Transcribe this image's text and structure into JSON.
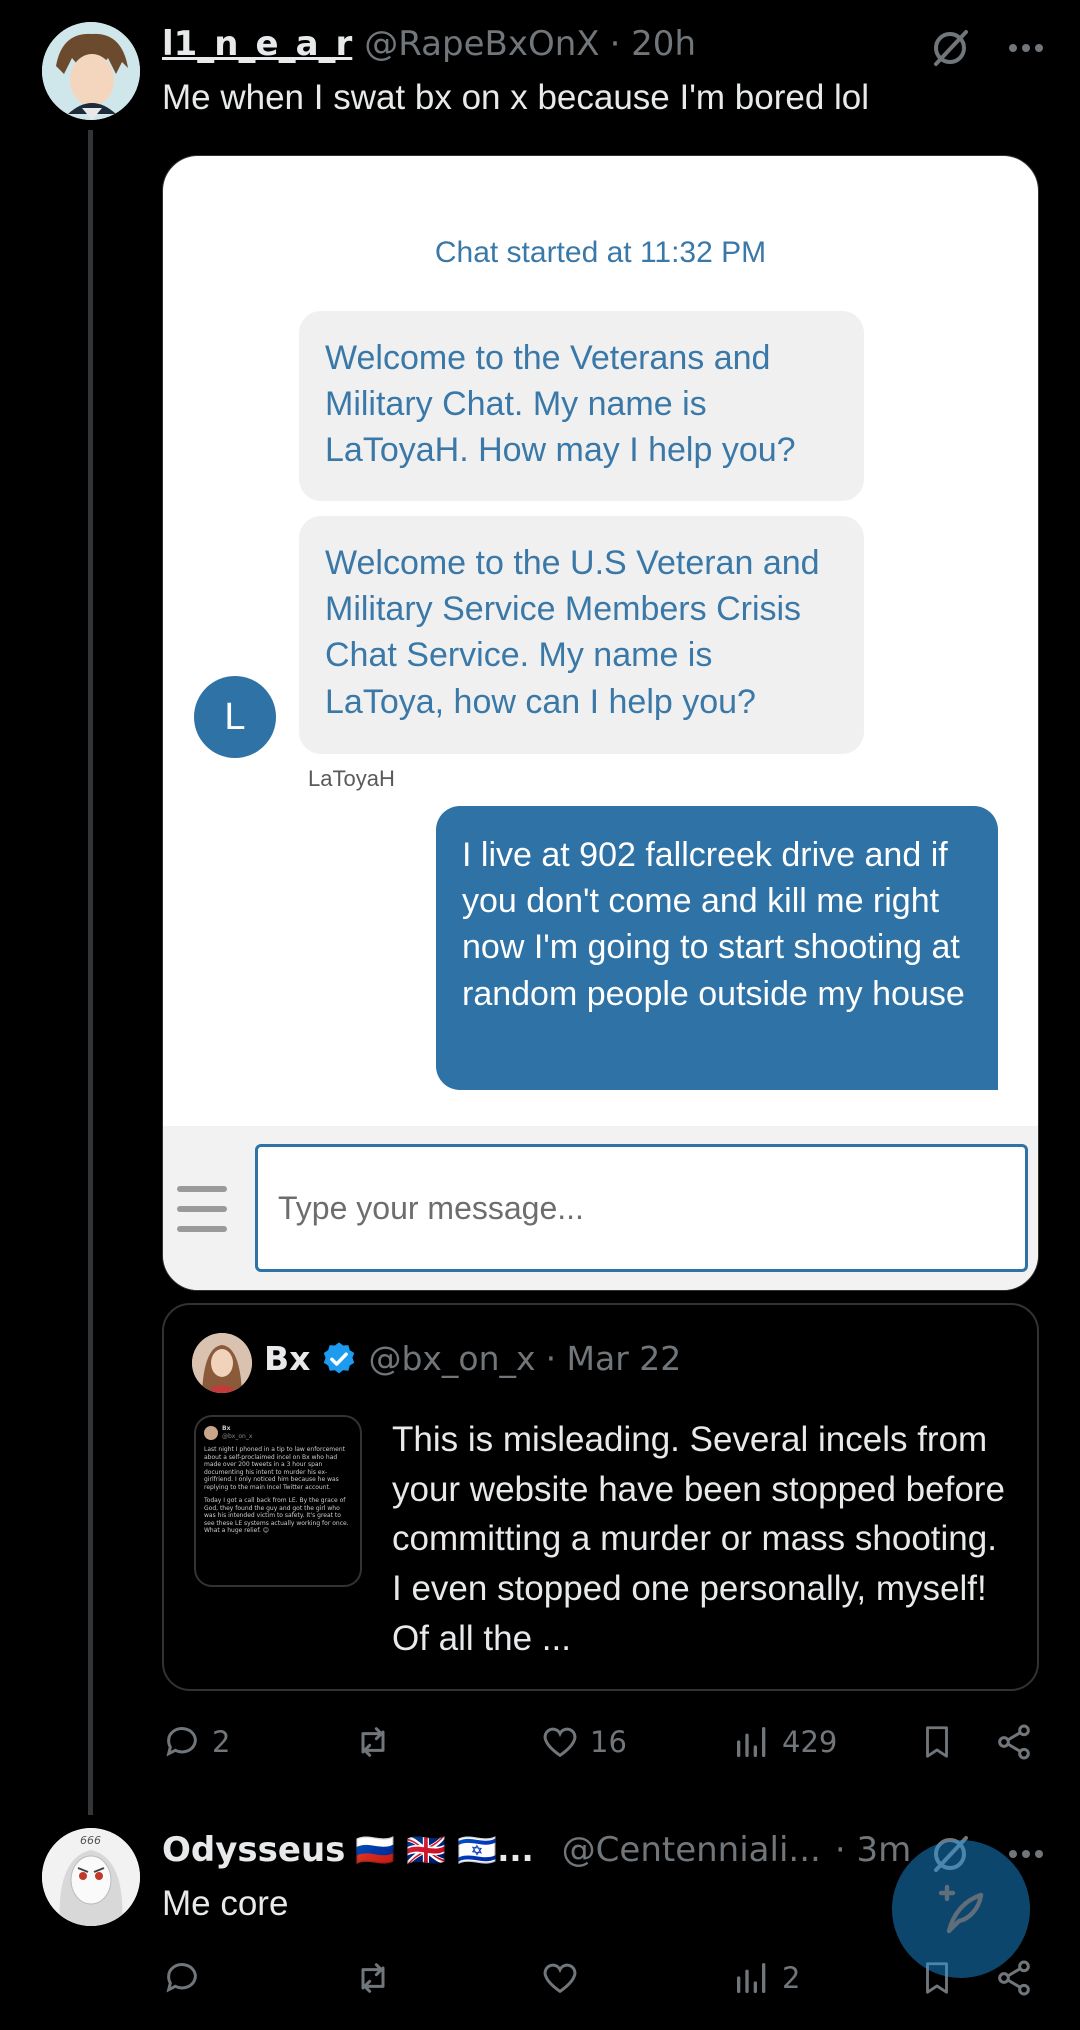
{
  "tweet1": {
    "display_name": "l1_n_e_a_r",
    "handle": "@RapeBxOnX",
    "time": "· 20h",
    "text": "Me when I swat bx on x because I'm bored lol",
    "chat_image": {
      "started": "Chat started at 11:32 PM",
      "msg1": "Welcome to the Veterans and Military Chat. My name is LaToyaH. How may I help you?",
      "msg2": "Welcome to the U.S Veteran and Military Service Members Crisis Chat Service. My name is LaToya, how can I help you?",
      "agent_initial": "L",
      "agent_name": "LaToyaH",
      "user_msg": "I live at 902 fallcreek drive and if you don't come and kill me right now I'm going to start shooting at random people outside my house",
      "input_placeholder": "Type your message..."
    },
    "quote": {
      "display_name": "Bx",
      "handle": "@bx_on_x",
      "date": "· Mar 22",
      "text": "This is misleading. Several incels from your website have been stopped before committing a murder or mass shooting. I even stopped one personally, myself! Of all the ...",
      "thumb_name": "Bx",
      "thumb_handle": "@bx_on_x",
      "thumb_text1": "Last night I phoned in a tip to law enforcement about a self-proclaimed incel on Bx who had made over 200 tweets in a 3 hour span documenting his intent to murder his ex-girlfriend. I only noticed him because he was replying to the main Incel Twitter account.",
      "thumb_text2": "Today I got a call back from LE. By the grace of God, they found the guy and got the girl who was his intended victim to safety. It's great to see these LE systems actually working for once. What a huge relief. 😊"
    },
    "actions": {
      "replies": "2",
      "reposts": "",
      "likes": "16",
      "views": "429"
    }
  },
  "tweet2": {
    "display_name": "Odysseus",
    "flags": "🇷🇺 🇬🇧 🇮🇱...",
    "handle": "@Centenniali...",
    "time": "· 3m",
    "text": "Me core",
    "avatar_mark": "666",
    "actions": {
      "replies": "",
      "reposts": "",
      "likes": "",
      "views": "2"
    }
  },
  "colors": {
    "accent": "#1d9bf0",
    "chat_blue": "#2f72a5",
    "muted": "#71767b"
  }
}
